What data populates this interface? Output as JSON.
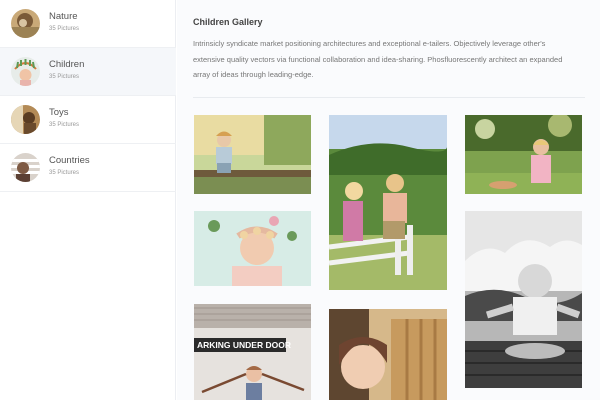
{
  "albums": [
    {
      "name": "Nature",
      "count": "35 Pictures",
      "thumb_icon": "nature-thumb-icon"
    },
    {
      "name": "Children",
      "count": "35 Pictures",
      "thumb_icon": "children-thumb-icon"
    },
    {
      "name": "Toys",
      "count": "35 Pictures",
      "thumb_icon": "toys-thumb-icon"
    },
    {
      "name": "Countries",
      "count": "35 Pictures",
      "thumb_icon": "countries-thumb-icon"
    }
  ],
  "gallery": {
    "title": "Children Gallery",
    "description": "Intrinsicly syndicate market positioning architectures and exceptional e-tailers. Objectively leverage other's extensive quality vectors via functional collaboration and idea-sharing. Phosfluorescently architect an expanded array of ideas through leading-edge.",
    "sign_text": "ARKING UNDER DOOR"
  },
  "colors": {
    "active_item_bg": "#f5f7fa",
    "sidebar_border": "#eceef2",
    "main_bg": "#fafbfd"
  }
}
